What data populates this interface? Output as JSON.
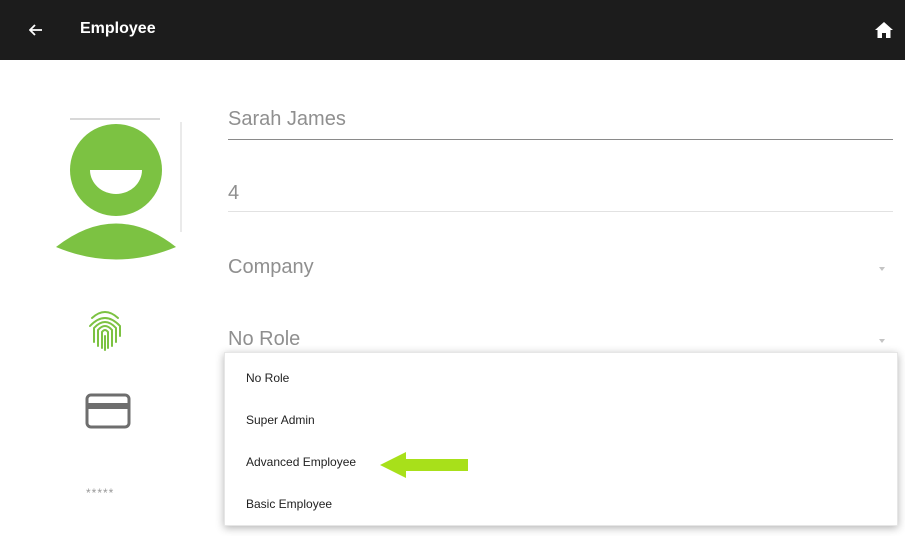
{
  "app_bar": {
    "title": "Employee",
    "back_icon": "arrow-left",
    "home_icon": "home",
    "background": "#1c1c1c"
  },
  "sidebar": {
    "avatar_icon": "person-avatar",
    "fingerprint_icon": "fingerprint",
    "card_icon": "credit-card",
    "pin_text": "*****",
    "accent": "#7cc242"
  },
  "form": {
    "name_value": "Sarah James",
    "id_value": "4",
    "company_placeholder": "Company",
    "role_value": "No Role"
  },
  "role_dropdown": {
    "options": [
      "No Role",
      "Super Admin",
      "Advanced Employee",
      "Basic Employee"
    ],
    "highlight_arrow_color": "#a8e01a"
  }
}
